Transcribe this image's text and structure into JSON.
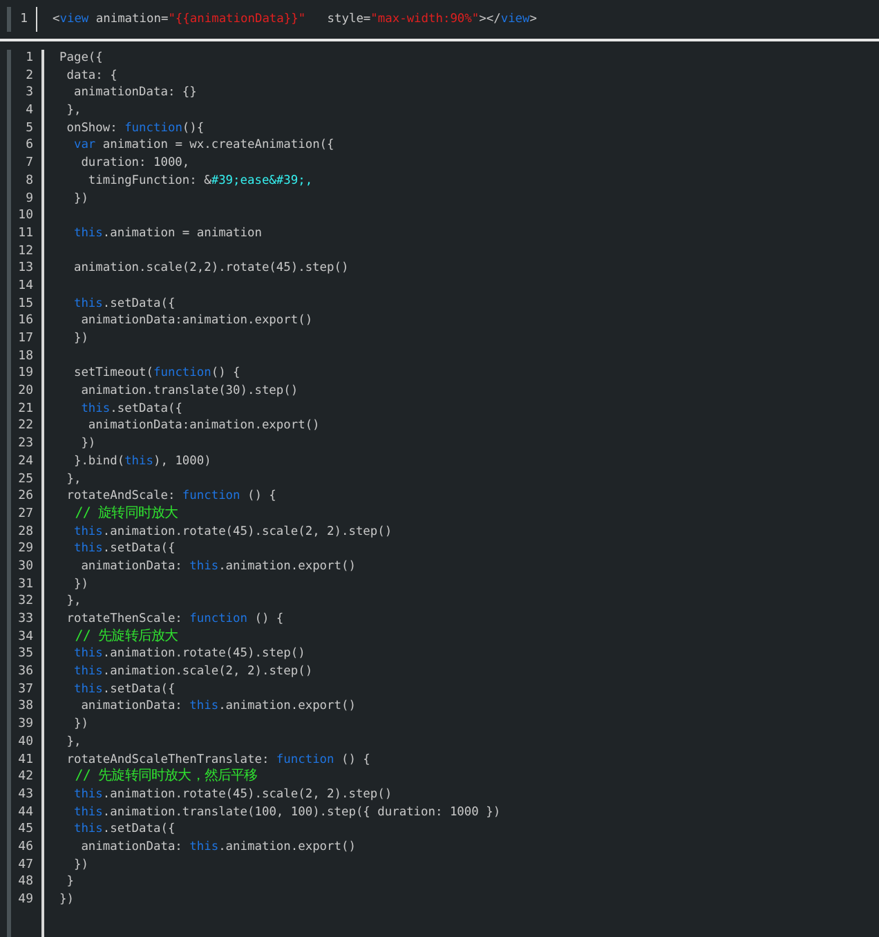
{
  "template_editor": {
    "lines": [
      {
        "number": "1",
        "segments": [
          {
            "kind": "plain",
            "text": "<"
          },
          {
            "kind": "keyword",
            "text": "view"
          },
          {
            "kind": "plain",
            "text": " animation="
          },
          {
            "kind": "string",
            "text": "\"{{animationData}}\""
          },
          {
            "kind": "plain",
            "text": "   style="
          },
          {
            "kind": "string",
            "text": "\"max-width:90%\""
          },
          {
            "kind": "plain",
            "text": "></"
          },
          {
            "kind": "keyword",
            "text": "view"
          },
          {
            "kind": "plain",
            "text": ">"
          }
        ]
      }
    ]
  },
  "script_editor": {
    "lines": [
      {
        "number": "1",
        "segments": [
          {
            "kind": "plain",
            "text": "Page({"
          }
        ]
      },
      {
        "number": "2",
        "segments": [
          {
            "kind": "plain",
            "text": " data: {"
          }
        ]
      },
      {
        "number": "3",
        "segments": [
          {
            "kind": "plain",
            "text": "  animationData: {}"
          }
        ]
      },
      {
        "number": "4",
        "segments": [
          {
            "kind": "plain",
            "text": " },"
          }
        ]
      },
      {
        "number": "5",
        "segments": [
          {
            "kind": "plain",
            "text": " onShow: "
          },
          {
            "kind": "keyword",
            "text": "function"
          },
          {
            "kind": "plain",
            "text": "(){"
          }
        ]
      },
      {
        "number": "6",
        "segments": [
          {
            "kind": "keyword",
            "text": "  var"
          },
          {
            "kind": "plain",
            "text": " animation = wx.createAnimation({"
          }
        ]
      },
      {
        "number": "7",
        "segments": [
          {
            "kind": "plain",
            "text": "   duration: 1000,"
          }
        ]
      },
      {
        "number": "8",
        "segments": [
          {
            "kind": "plain",
            "text": "    timingFunction: &"
          },
          {
            "kind": "entity",
            "text": "#39;ease&#39;,"
          }
        ]
      },
      {
        "number": "9",
        "segments": [
          {
            "kind": "plain",
            "text": "  })"
          }
        ]
      },
      {
        "number": "10"
      },
      {
        "number": "11",
        "segments": [
          {
            "kind": "keyword",
            "text": "  this"
          },
          {
            "kind": "plain",
            "text": ".animation = animation"
          }
        ]
      },
      {
        "number": "12"
      },
      {
        "number": "13",
        "segments": [
          {
            "kind": "plain",
            "text": "  animation.scale(2,2).rotate(45).step()"
          }
        ]
      },
      {
        "number": "14"
      },
      {
        "number": "15",
        "segments": [
          {
            "kind": "keyword",
            "text": "  this"
          },
          {
            "kind": "plain",
            "text": ".setData({"
          }
        ]
      },
      {
        "number": "16",
        "segments": [
          {
            "kind": "plain",
            "text": "   animationData:animation.export()"
          }
        ]
      },
      {
        "number": "17",
        "segments": [
          {
            "kind": "plain",
            "text": "  })"
          }
        ]
      },
      {
        "number": "18"
      },
      {
        "number": "19",
        "segments": [
          {
            "kind": "plain",
            "text": "  setTimeout("
          },
          {
            "kind": "keyword",
            "text": "function"
          },
          {
            "kind": "plain",
            "text": "() {"
          }
        ]
      },
      {
        "number": "20",
        "segments": [
          {
            "kind": "plain",
            "text": "   animation.translate(30).step()"
          }
        ]
      },
      {
        "number": "21",
        "segments": [
          {
            "kind": "keyword",
            "text": "   this"
          },
          {
            "kind": "plain",
            "text": ".setData({"
          }
        ]
      },
      {
        "number": "22",
        "segments": [
          {
            "kind": "plain",
            "text": "    animationData:animation.export()"
          }
        ]
      },
      {
        "number": "23",
        "segments": [
          {
            "kind": "plain",
            "text": "   })"
          }
        ]
      },
      {
        "number": "24",
        "segments": [
          {
            "kind": "plain",
            "text": "  }.bind("
          },
          {
            "kind": "keyword",
            "text": "this"
          },
          {
            "kind": "plain",
            "text": "), 1000)"
          }
        ]
      },
      {
        "number": "25",
        "segments": [
          {
            "kind": "plain",
            "text": " },"
          }
        ]
      },
      {
        "number": "26",
        "segments": [
          {
            "kind": "plain",
            "text": " rotateAndScale: "
          },
          {
            "kind": "keyword",
            "text": "function"
          },
          {
            "kind": "plain",
            "text": " () {"
          }
        ]
      },
      {
        "number": "27",
        "segments": [
          {
            "kind": "comment",
            "text": "  // 旋转同时放大"
          }
        ]
      },
      {
        "number": "28",
        "segments": [
          {
            "kind": "keyword",
            "text": "  this"
          },
          {
            "kind": "plain",
            "text": ".animation.rotate(45).scale(2, 2).step()"
          }
        ]
      },
      {
        "number": "29",
        "segments": [
          {
            "kind": "keyword",
            "text": "  this"
          },
          {
            "kind": "plain",
            "text": ".setData({"
          }
        ]
      },
      {
        "number": "30",
        "segments": [
          {
            "kind": "plain",
            "text": "   animationData: "
          },
          {
            "kind": "keyword",
            "text": "this"
          },
          {
            "kind": "plain",
            "text": ".animation.export()"
          }
        ]
      },
      {
        "number": "31",
        "segments": [
          {
            "kind": "plain",
            "text": "  })"
          }
        ]
      },
      {
        "number": "32",
        "segments": [
          {
            "kind": "plain",
            "text": " },"
          }
        ]
      },
      {
        "number": "33",
        "segments": [
          {
            "kind": "plain",
            "text": " rotateThenScale: "
          },
          {
            "kind": "keyword",
            "text": "function"
          },
          {
            "kind": "plain",
            "text": " () {"
          }
        ]
      },
      {
        "number": "34",
        "segments": [
          {
            "kind": "comment",
            "text": "  // 先旋转后放大"
          }
        ]
      },
      {
        "number": "35",
        "segments": [
          {
            "kind": "keyword",
            "text": "  this"
          },
          {
            "kind": "plain",
            "text": ".animation.rotate(45).step()"
          }
        ]
      },
      {
        "number": "36",
        "segments": [
          {
            "kind": "keyword",
            "text": "  this"
          },
          {
            "kind": "plain",
            "text": ".animation.scale(2, 2).step()"
          }
        ]
      },
      {
        "number": "37",
        "segments": [
          {
            "kind": "keyword",
            "text": "  this"
          },
          {
            "kind": "plain",
            "text": ".setData({"
          }
        ]
      },
      {
        "number": "38",
        "segments": [
          {
            "kind": "plain",
            "text": "   animationData: "
          },
          {
            "kind": "keyword",
            "text": "this"
          },
          {
            "kind": "plain",
            "text": ".animation.export()"
          }
        ]
      },
      {
        "number": "39",
        "segments": [
          {
            "kind": "plain",
            "text": "  })"
          }
        ]
      },
      {
        "number": "40",
        "segments": [
          {
            "kind": "plain",
            "text": " },"
          }
        ]
      },
      {
        "number": "41",
        "segments": [
          {
            "kind": "plain",
            "text": " rotateAndScaleThenTranslate: "
          },
          {
            "kind": "keyword",
            "text": "function"
          },
          {
            "kind": "plain",
            "text": " () {"
          }
        ]
      },
      {
        "number": "42",
        "segments": [
          {
            "kind": "comment",
            "text": "  // 先旋转同时放大，然后平移"
          }
        ]
      },
      {
        "number": "43",
        "segments": [
          {
            "kind": "keyword",
            "text": "  this"
          },
          {
            "kind": "plain",
            "text": ".animation.rotate(45).scale(2, 2).step()"
          }
        ]
      },
      {
        "number": "44",
        "segments": [
          {
            "kind": "keyword",
            "text": "  this"
          },
          {
            "kind": "plain",
            "text": ".animation.translate(100, 100).step({ duration: 1000 })"
          }
        ]
      },
      {
        "number": "45",
        "segments": [
          {
            "kind": "keyword",
            "text": "  this"
          },
          {
            "kind": "plain",
            "text": ".setData({"
          }
        ]
      },
      {
        "number": "46",
        "segments": [
          {
            "kind": "plain",
            "text": "   animationData: "
          },
          {
            "kind": "keyword",
            "text": "this"
          },
          {
            "kind": "plain",
            "text": ".animation.export()"
          }
        ]
      },
      {
        "number": "47",
        "segments": [
          {
            "kind": "plain",
            "text": "  })"
          }
        ]
      },
      {
        "number": "48",
        "segments": [
          {
            "kind": "plain",
            "text": " }"
          }
        ]
      },
      {
        "number": "49",
        "segments": [
          {
            "kind": "plain",
            "text": "})"
          }
        ]
      }
    ]
  }
}
